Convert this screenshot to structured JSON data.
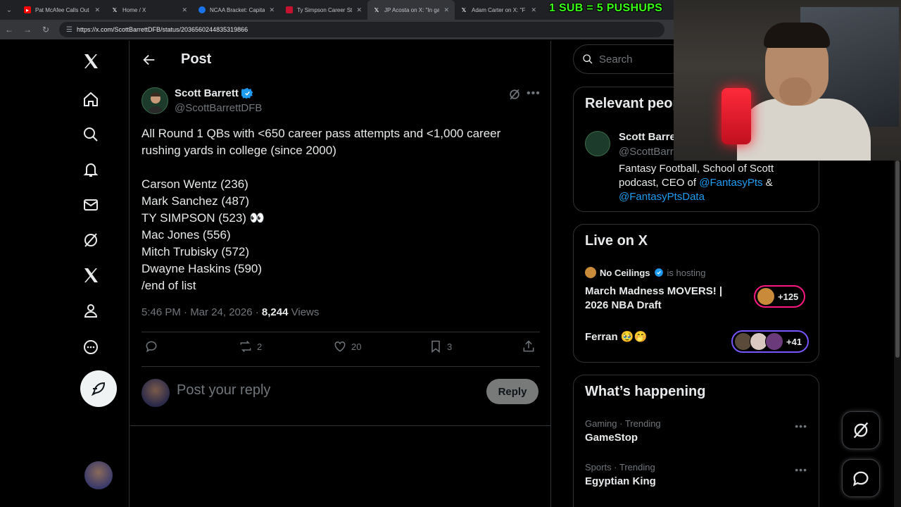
{
  "browser": {
    "tabs": [
      {
        "title": "Pat McAfee Calls Out",
        "favicon_color": "#ff0000"
      },
      {
        "title": "Home / X",
        "favicon_color": "#000000"
      },
      {
        "title": "NCAA Bracket: Capita",
        "favicon_color": "#1a73e8"
      },
      {
        "title": "Ty Simpson Career St",
        "favicon_color": "#c41230"
      },
      {
        "title": "JP Acosta on X: \"In ga",
        "favicon_color": "#000000"
      },
      {
        "title": "Adam Carter on X: \"F",
        "favicon_color": "#000000"
      }
    ],
    "overlay_text": "1 SUB = 5 PUSHUPS",
    "url": "https://x.com/ScottBarrettDFB/status/2036560244835319866"
  },
  "post": {
    "header_title": "Post",
    "author_name": "Scott Barrett",
    "author_handle": "@ScottBarrettDFB",
    "text_lines": [
      "All Round 1 QBs with <650 career pass attempts and <1,000 career",
      "rushing yards in college (since 2000)",
      "",
      "Carson Wentz (236)",
      "Mark Sanchez (487)",
      "TY SIMPSON (523) 👀",
      "Mac Jones (556)",
      "Mitch Trubisky (572)",
      "Dwayne Haskins (590)",
      "/end of list"
    ],
    "timestamp": "5:46 PM · Mar 24, 2026 · ",
    "views_count": "8,244",
    "views_label": " Views",
    "reposts": "2",
    "likes": "20",
    "bookmarks": "3",
    "reply_placeholder": "Post your reply",
    "reply_button": "Reply"
  },
  "sidebar": {
    "search_placeholder": "Search",
    "relevant_title": "Relevant people",
    "relevant_name": "Scott Barrett",
    "relevant_handle": "@ScottBarrettDFB",
    "bio_prefix": "Fantasy Football, School of Scott podcast, CEO of ",
    "bio_link1": "@FantasyPts",
    "bio_mid": " & ",
    "bio_link2": "@FantasyPtsData",
    "live_title": "Live on X",
    "live1_host": "No Ceilings",
    "live1_hosting": "is hosting",
    "live1_title": "March Madness MOVERS! | 2026 NBA Draft",
    "live1_count": "+125",
    "live2_title": "Ferran 🥹🤭",
    "live2_count": "+41",
    "happening_title": "What’s happening",
    "trends": [
      {
        "meta": "Gaming · Trending",
        "name": "GameStop"
      },
      {
        "meta": "Sports · Trending",
        "name": "Egyptian King"
      }
    ]
  }
}
